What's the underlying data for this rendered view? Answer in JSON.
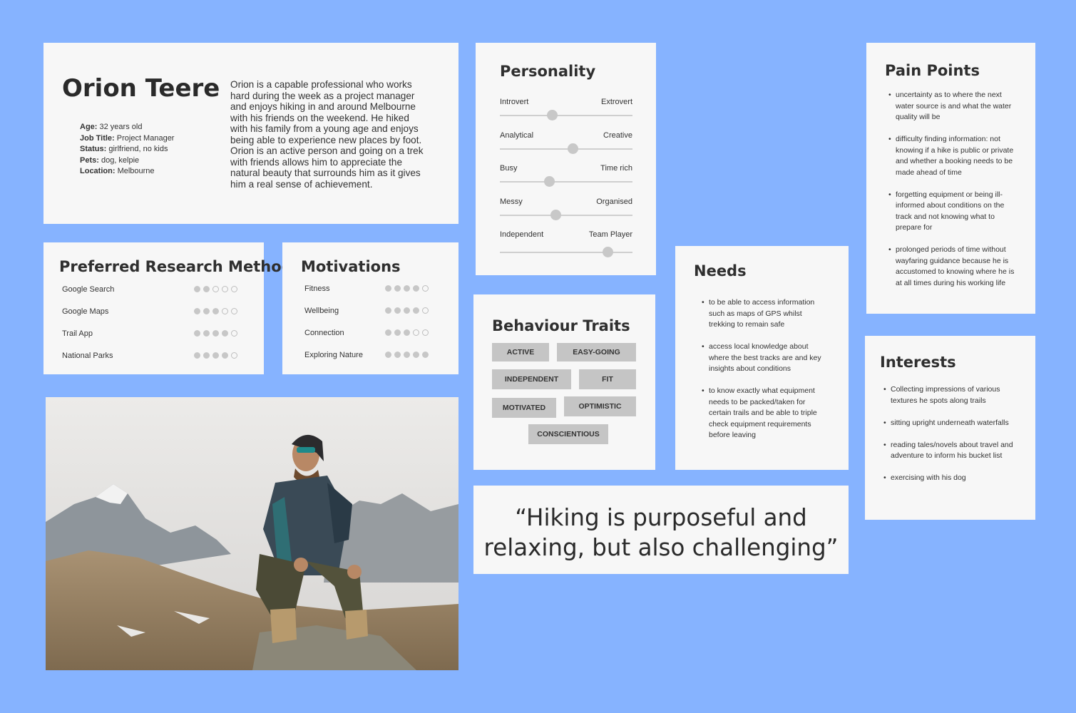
{
  "colors": {
    "background": "#86b3ff",
    "card": "#f7f7f7",
    "tag": "#c5c5c5",
    "dot_filled": "#c7c7c7"
  },
  "profile": {
    "name": "Orion Teere",
    "details": [
      {
        "label": "Age:",
        "value": "32 years old"
      },
      {
        "label": "Job Title:",
        "value": "Project Manager"
      },
      {
        "label": "Status:",
        "value": "girlfriend, no kids"
      },
      {
        "label": "Pets:",
        "value": "dog, kelpie"
      },
      {
        "label": "Location:",
        "value": "Melbourne"
      }
    ],
    "bio": "Orion is a capable professional who works hard during the week as a project manager and enjoys hiking in and around Melbourne with his friends on the weekend. He hiked with his family from a young age and enjoys being able to experience new places by foot. Orion is an active person and going on a trek with friends allows him to appreciate the natural beauty that surrounds him as it gives him a real sense of achievement."
  },
  "research": {
    "title": "Preferred Research Methods",
    "items": [
      {
        "label": "Google Search",
        "rating": 2,
        "max": 5
      },
      {
        "label": "Google Maps",
        "rating": 3,
        "max": 5
      },
      {
        "label": "Trail App",
        "rating": 4,
        "max": 5
      },
      {
        "label": "National Parks",
        "rating": 4,
        "max": 5
      }
    ]
  },
  "motivations": {
    "title": "Motivations",
    "items": [
      {
        "label": "Fitness",
        "rating": 4,
        "max": 5
      },
      {
        "label": "Wellbeing",
        "rating": 4,
        "max": 5
      },
      {
        "label": "Connection",
        "rating": 3,
        "max": 5
      },
      {
        "label": "Exploring Nature",
        "rating": 5,
        "max": 5
      }
    ]
  },
  "personality": {
    "title": "Personality",
    "sliders": [
      {
        "left": "Introvert",
        "right": "Extrovert",
        "value": 0.39
      },
      {
        "left": "Analytical",
        "right": "Creative",
        "value": 0.55
      },
      {
        "left": "Busy",
        "right": "Time rich",
        "value": 0.37
      },
      {
        "left": "Messy",
        "right": "Organised",
        "value": 0.42
      },
      {
        "left": "Independent",
        "right": "Team Player",
        "value": 0.81
      }
    ]
  },
  "traits": {
    "title": "Behaviour Traits",
    "tags": [
      "ACTIVE",
      "EASY-GOING",
      "INDEPENDENT",
      "FIT",
      "MOTIVATED",
      "OPTIMISTIC",
      "CONSCIENTIOUS"
    ]
  },
  "needs": {
    "title": "Needs",
    "items": [
      "to be able to access information such as maps of GPS whilst trekking to remain safe",
      "access local knowledge about where the best tracks are and key insights about conditions",
      "to know exactly what equipment needs to be packed/taken for certain trails and be able to triple check equipment requirements before leaving"
    ]
  },
  "pain": {
    "title": "Pain Points",
    "items": [
      "uncertainty as to where the next water source is and what the water quality will be",
      "difficulty finding information: not knowing if a hike is public or private and whether a booking needs to be made ahead of time",
      "forgetting equipment or being ill-informed about conditions on the track and not knowing what to prepare for",
      "prolonged periods of time without wayfaring guidance because he is accustomed to knowing where he is at all times during his working life"
    ]
  },
  "interests": {
    "title": "Interests",
    "items": [
      "Collecting impressions of various textures he spots along trails",
      "sitting upright underneath waterfalls",
      "reading tales/novels about travel and adventure to inform his bucket list",
      "exercising with his dog"
    ]
  },
  "quote": {
    "text": "“Hiking is purposeful and relaxing, but also challenging”"
  }
}
